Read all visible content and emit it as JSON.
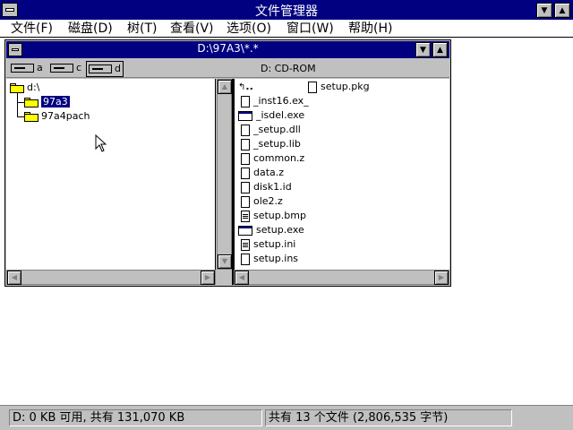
{
  "app": {
    "title": "文件管理器"
  },
  "menu": [
    "文件(F)",
    "磁盘(D)",
    "树(T)",
    "查看(V)",
    "选项(O)",
    "窗口(W)",
    "帮助(H)"
  ],
  "child_window": {
    "title": "D:\\97A3\\*.*"
  },
  "drives": [
    {
      "letter": "a"
    },
    {
      "letter": "c"
    },
    {
      "letter": "d"
    }
  ],
  "volume_label": "D: CD-ROM",
  "tree": {
    "root": "d:\\",
    "items": [
      "97a3",
      "97a4pach"
    ]
  },
  "files": {
    "up": "..",
    "list": [
      {
        "name": "_inst16.ex_",
        "icon": "file-icon"
      },
      {
        "name": "_isdel.exe",
        "icon": "exe-icon"
      },
      {
        "name": "_setup.dll",
        "icon": "file-icon"
      },
      {
        "name": "_setup.lib",
        "icon": "file-icon"
      },
      {
        "name": "common.z",
        "icon": "file-icon"
      },
      {
        "name": "data.z",
        "icon": "file-icon"
      },
      {
        "name": "disk1.id",
        "icon": "file-icon"
      },
      {
        "name": "ole2.z",
        "icon": "file-icon"
      },
      {
        "name": "setup.bmp",
        "icon": "doc-icon"
      },
      {
        "name": "setup.exe",
        "icon": "exe-icon"
      },
      {
        "name": "setup.ini",
        "icon": "doc-icon"
      },
      {
        "name": "setup.ins",
        "icon": "file-icon"
      }
    ],
    "column2": [
      {
        "name": "setup.pkg",
        "icon": "file-icon"
      }
    ]
  },
  "status": {
    "left": "D: 0 KB 可用, 共有 131,070 KB",
    "right": "共有 13 个文件 (2,806,535 字节)"
  }
}
